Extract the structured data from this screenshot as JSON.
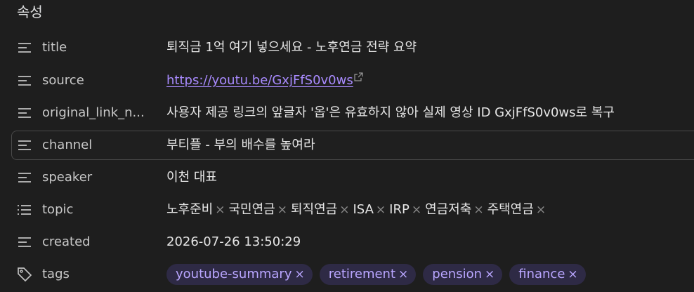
{
  "panel": {
    "title": "속성"
  },
  "properties": [
    {
      "key": "title",
      "icon": "text-lines-icon",
      "value": "퇴직금 1억 여기 넣으세요 - 노후연금 전략 요약"
    },
    {
      "key": "source",
      "icon": "text-lines-icon",
      "link": "https://youtu.be/GxjFfS0v0ws"
    },
    {
      "key": "original_link_n...",
      "icon": "text-lines-icon",
      "value": "사용자 제공 링크의 앞글자 '옵'은 유효하지 않아 실제 영상 ID GxjFfS0v0ws로 복구"
    },
    {
      "key": "channel",
      "icon": "text-lines-icon",
      "value": "부티플 - 부의 배수를 높여라"
    },
    {
      "key": "speaker",
      "icon": "text-lines-icon",
      "value": "이천 대표"
    },
    {
      "key": "topic",
      "icon": "list-icon",
      "items": [
        "노후준비",
        "국민연금",
        "퇴직연금",
        "ISA",
        "IRP",
        "연금저축",
        "주택연금"
      ]
    },
    {
      "key": "created",
      "icon": "text-lines-icon",
      "value": "2026-07-26 13:50:29"
    },
    {
      "key": "tags",
      "icon": "tag-icon",
      "tags": [
        "youtube-summary",
        "retirement",
        "pension",
        "finance"
      ]
    }
  ],
  "remove_glyph": "×",
  "colors": {
    "background": "#1e1e1e",
    "link": "#a98bff",
    "tag_background": "#2e2a45",
    "tag_text": "#b9a6ff"
  }
}
